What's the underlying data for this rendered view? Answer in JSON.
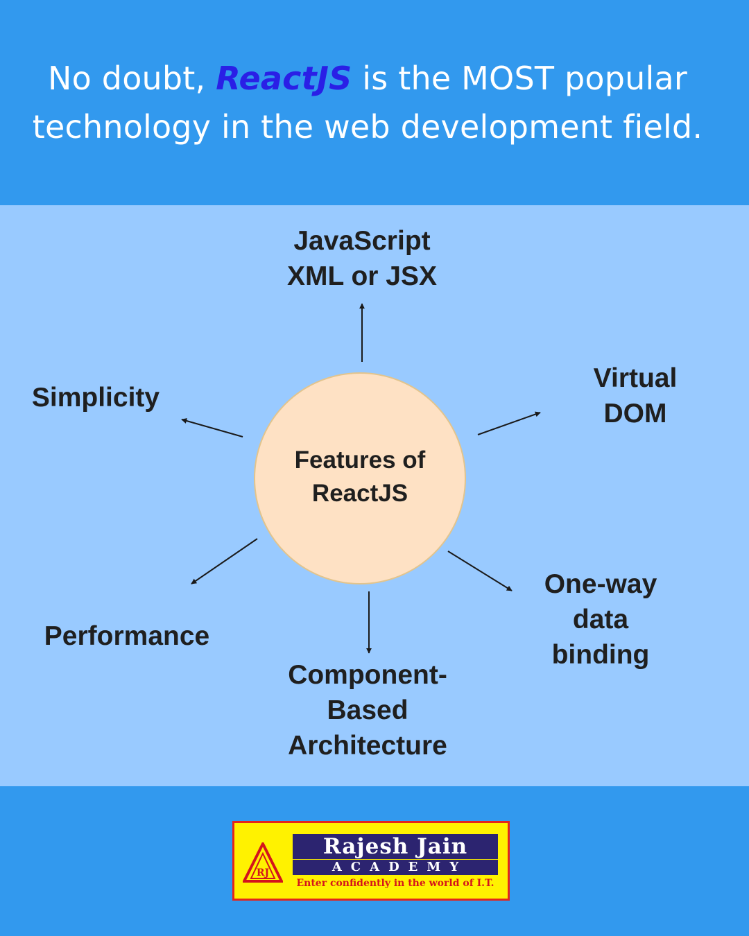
{
  "header": {
    "line1_pre": "No doubt,  ",
    "line1_brand": "ReactJS",
    "line1_post": "  is the MOST popular",
    "line2": "technology in the web development field."
  },
  "diagram": {
    "center": [
      "Features of",
      "ReactJS"
    ],
    "features": [
      {
        "id": "jsx",
        "lines": [
          "JavaScript",
          "XML or JSX"
        ]
      },
      {
        "id": "virtual-dom",
        "lines": [
          "Virtual",
          "DOM"
        ]
      },
      {
        "id": "one-way-binding",
        "lines": [
          "One-way",
          "data",
          "binding"
        ]
      },
      {
        "id": "component-architecture",
        "lines": [
          "Component-",
          "Based",
          "Architecture"
        ]
      },
      {
        "id": "performance",
        "lines": [
          "Performance"
        ]
      },
      {
        "id": "simplicity",
        "lines": [
          "Simplicity"
        ]
      }
    ]
  },
  "logo": {
    "mark": "RJ",
    "title": "Rajesh Jain",
    "subtitle": "ACADEMY",
    "tagline": "Enter confidently in the world of I.T."
  },
  "colors": {
    "header_bg": "#3299ee",
    "panel_bg": "#99caff",
    "brand_text": "#2a1fe6",
    "circle_fill": "#fee1c4",
    "logo_bg": "#fff200",
    "logo_navy": "#2c2470",
    "logo_red": "#d4141c"
  }
}
